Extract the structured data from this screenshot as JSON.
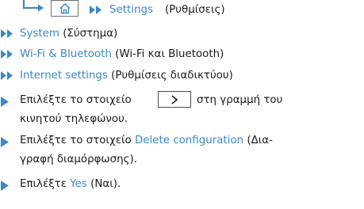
{
  "path": {
    "main_label": "Settings",
    "main_label_gr": "(Ρυθμίσεις)",
    "items": [
      {
        "label": "System",
        "label_gr": "(Σύστημα)"
      },
      {
        "label": "Wi-Fi & Bluetooth",
        "label_gr": "(Wi-Fi και Bluetooth)"
      },
      {
        "label": "Internet settings",
        "label_gr": "(Ρυθμίσεις διαδικτύου)"
      }
    ]
  },
  "steps": {
    "step1_pre": "Επιλέξτε το στοιχείο",
    "step1_post": "στη γραμμή του",
    "step1_line2": "κινητού τηλεφώνου.",
    "step2_pre": "Επιλέξτε το στοιχείο",
    "step2_link": "Delete configuration",
    "step2_post": "(Δια-",
    "step2_line2": "γραφή διαμόρφωσης).",
    "step3_pre": "Επιλέξτε",
    "step3_link": "Yes",
    "step3_post": "(Ναι)."
  },
  "colors": {
    "link_blue": "#3b87c8",
    "text": "#1a1a1a"
  }
}
